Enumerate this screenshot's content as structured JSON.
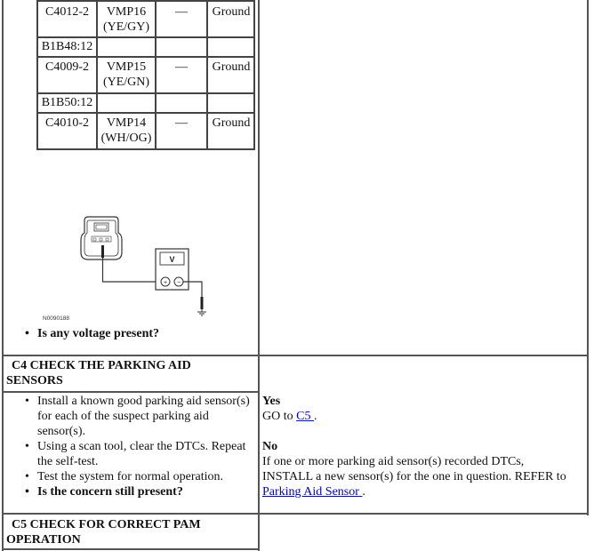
{
  "pin_table": {
    "rows": [
      {
        "connector": "C4012-2",
        "circuit": "VMP16",
        "color": "(YE/GY)",
        "dash": "—",
        "target": "Ground"
      },
      {
        "group": "B1B48:12"
      },
      {
        "connector": "C4009-2",
        "circuit": "VMP15",
        "color": "(YE/GN)",
        "dash": "—",
        "target": "Ground"
      },
      {
        "group": "B1B50:12"
      },
      {
        "connector": "C4010-2",
        "circuit": "VMP14",
        "color": "(WH/OG)",
        "dash": "—",
        "target": "Ground"
      }
    ]
  },
  "diagram": {
    "meter_label": "V",
    "plus": "+",
    "minus": "−",
    "figure_id": "N0090188"
  },
  "c3_question": "Is any voltage present?",
  "c4": {
    "title_line1": "C4 CHECK THE PARKING AID",
    "title_line2": "SENSORS",
    "steps": [
      {
        "lines": [
          "Install a known good parking aid sensor(s)",
          "for each of the suspect parking aid",
          "sensor(s)."
        ],
        "bold": false
      },
      {
        "lines": [
          "Using a scan tool, clear the DTCs. Repeat",
          "the self-test."
        ],
        "bold": false
      },
      {
        "lines": [
          "Test the system for normal operation."
        ],
        "bold": false
      },
      {
        "lines": [
          "Is the concern still present?"
        ],
        "bold": true
      }
    ],
    "yes_label": "Yes",
    "yes_text_prefix": "GO to ",
    "yes_link": "C5 ",
    "yes_text_suffix": ".",
    "no_label": "No",
    "no_line1": "If one or more parking aid sensor(s) recorded DTCs,",
    "no_line2": "INSTALL a new sensor(s) for the one in question. REFER to",
    "no_link": "Parking Aid Sensor ",
    "no_suffix": "."
  },
  "c5": {
    "title_line1": "C5 CHECK FOR CORRECT PAM",
    "title_line2": "OPERATION"
  }
}
